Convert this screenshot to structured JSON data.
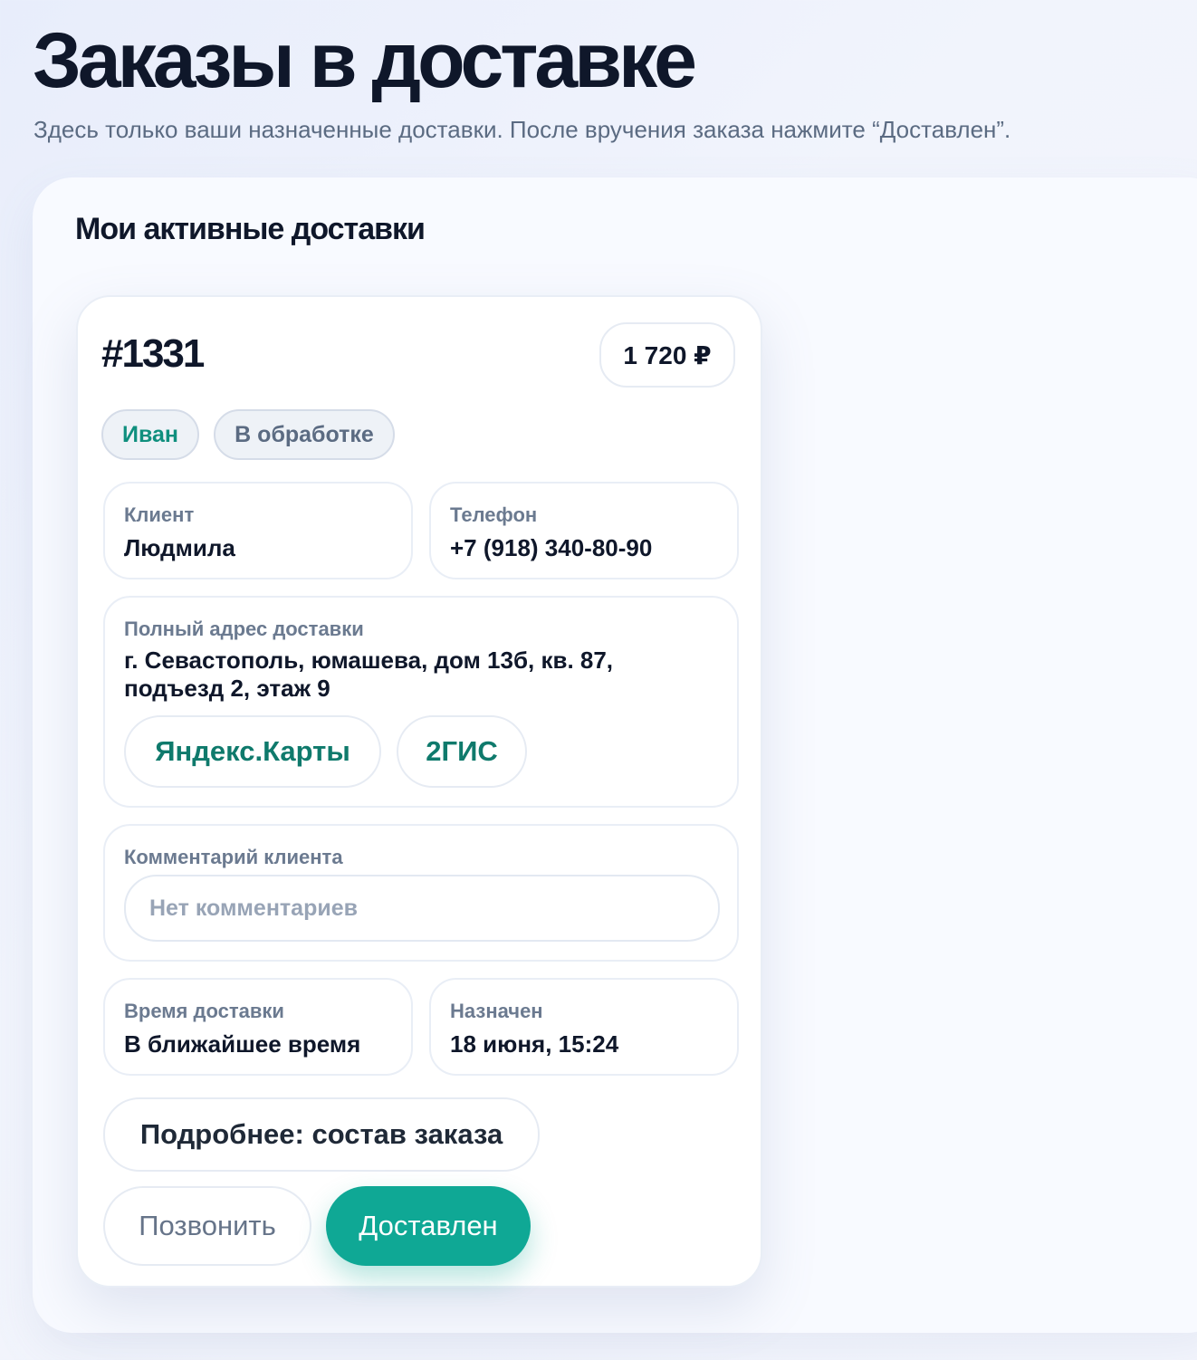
{
  "header": {
    "title": "Заказы в доставке",
    "subtitle": "Здесь только ваши назначенные доставки. После вручения заказа нажмите “Доставлен”."
  },
  "panel": {
    "title": "Мои активные доставки"
  },
  "order": {
    "number": "#1331",
    "price": "1 720 ₽",
    "courier_tag": "Иван",
    "status_tag": "В обработке",
    "client_label": "Клиент",
    "client_value": "Людмила",
    "phone_label": "Телефон",
    "phone_value": "+7 (918) 340-80-90",
    "address_label": "Полный адрес доставки",
    "address_value": "г. Севастополь, юмашева, дом 13б, кв. 87, подъезд 2, этаж 9",
    "map_yandex": "Яндекс.Карты",
    "map_2gis": "2ГИС",
    "comment_label": "Комментарий клиента",
    "comment_value": "Нет комментариев",
    "time_label": "Время доставки",
    "time_value": "В ближайшее время",
    "assigned_label": "Назначен",
    "assigned_value": "18 июня, 15:24",
    "details_button": "Подробнее: состав заказа",
    "call_button": "Позвонить",
    "delivered_button": "Доставлен"
  },
  "colors": {
    "accent": "#0fa895",
    "tag_text_courier": "#0f8f7e",
    "map_link": "#0f7a6c",
    "heading": "#0f172a",
    "muted": "#5b6b82"
  }
}
